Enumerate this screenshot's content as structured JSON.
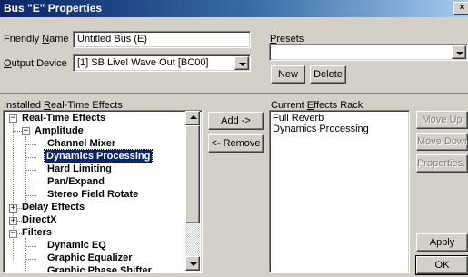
{
  "window": {
    "title": "Bus \"E\" Properties",
    "close_glyph": "×"
  },
  "friendly_name": {
    "label_pre": "Friendly ",
    "label_key": "N",
    "label_post": "ame",
    "value": "Untitled Bus (E)"
  },
  "output_device": {
    "label_key": "O",
    "label_post": "utput Device",
    "value": "[1] SB Live! Wave Out [BC00]"
  },
  "presets": {
    "label_key": "P",
    "label_post": "resets",
    "value": "",
    "new_label": "New",
    "delete_label": "Delete"
  },
  "installed_effects": {
    "label_pre": "Installed ",
    "label_key": "R",
    "label_post": "eal-Time Effects",
    "tree": [
      {
        "id": "real-time-effects",
        "label": "Real-Time Effects",
        "expander": "−"
      },
      {
        "id": "amplitude",
        "label": "Amplitude",
        "expander": "−"
      },
      {
        "id": "channel-mixer",
        "label": "Channel Mixer"
      },
      {
        "id": "dynamics-processing",
        "label": "Dynamics Processing",
        "selected": true
      },
      {
        "id": "hard-limiting",
        "label": "Hard Limiting"
      },
      {
        "id": "pan-expand",
        "label": "Pan/Expand"
      },
      {
        "id": "stereo-field-rotate",
        "label": "Stereo Field Rotate"
      },
      {
        "id": "delay-effects",
        "label": "Delay Effects",
        "expander": "+"
      },
      {
        "id": "directx",
        "label": "DirectX",
        "expander": "+"
      },
      {
        "id": "filters",
        "label": "Filters",
        "expander": "−"
      },
      {
        "id": "dynamic-eq",
        "label": "Dynamic EQ"
      },
      {
        "id": "graphic-equalizer",
        "label": "Graphic Equalizer"
      },
      {
        "id": "graphic-phase-shifter",
        "label": "Graphic Phase Shifter"
      }
    ]
  },
  "buttons": {
    "add": "Add ->",
    "remove": "<- Remove"
  },
  "current_rack": {
    "label_pre": "Current ",
    "label_key": "E",
    "label_post": "ffects Rack",
    "items": [
      "Full Reverb",
      "Dynamics Processing"
    ]
  },
  "side_buttons": {
    "move_up": "Move Up",
    "move_down": "Move Down",
    "properties": "Properties...",
    "apply": "Apply",
    "ok": "OK"
  },
  "colors": {
    "titlebar": "#0a246a",
    "selection": "#0a246a",
    "face": "#d4d0c8"
  }
}
